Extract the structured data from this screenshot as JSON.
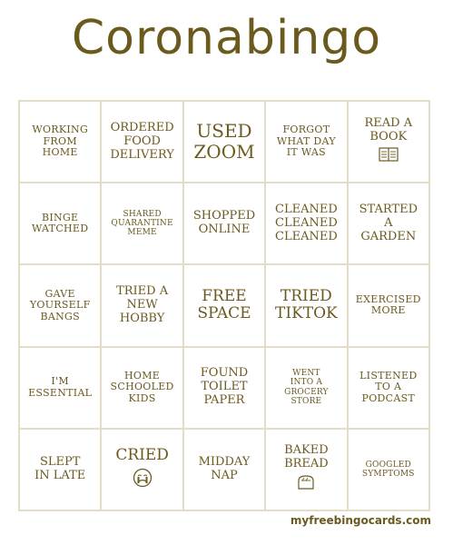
{
  "title": "Coronabingo",
  "colors": {
    "text": "#6b5a1e",
    "grid": "#e3dcc6",
    "background": "#ffffff"
  },
  "cells": [
    "Working\nfrom\nhome",
    "Ordered\nfood\ndelivery",
    "Used\nZoom",
    "Forgot\nwhat day\nit was",
    "Read a\nbook",
    "Binge\nwatched",
    "Shared\nquarantine\nmeme",
    "Shopped\nonline",
    "Cleaned\ncleaned\ncleaned",
    "Started\na\ngarden",
    "Gave\nyourself\nbangs",
    "Tried a\nnew\nhobby",
    "Free\nspace",
    "Tried\nTikTok",
    "Exercised\nmore",
    "I'm\nessential",
    "Home\nschooled\nkids",
    "Found\ntoilet\npaper",
    "Went\ninto a\ngrocery\nstore",
    "Listened\nto a\npodcast",
    "Slept\nin late",
    "Cried",
    "Midday\nnap",
    "Baked\nbread",
    "Googled\nsymptoms"
  ],
  "icons": {
    "book": "book-icon",
    "cry": "crying-face-icon",
    "bread": "bread-icon"
  },
  "footer": "myfreebingocards.com"
}
